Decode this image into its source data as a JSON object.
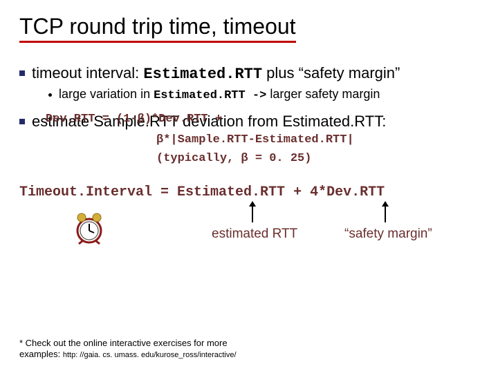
{
  "title": "TCP round trip time, timeout",
  "bullet1": {
    "lead": "timeout interval:",
    "code": "Estimated.RTT",
    "tail": " plus “safety margin”"
  },
  "sub1": {
    "a": "large variation in ",
    "code": "Estimated.RTT ->",
    "b": " larger safety margin"
  },
  "bullet2_overlap": "estimate Sample.RTT deviation from Estimated.RTT:",
  "dev_overlay": "Dev.RTT = (1-β)*Dev.RTT +",
  "formula2": "β*|Sample.RTT-Estimated.RTT|",
  "formula3": "(typically, β = 0. 25)",
  "timeout_formula": "Timeout.Interval = Estimated.RTT + 4*Dev.RTT",
  "label_est": "estimated RTT",
  "label_safety": "“safety margin”",
  "footnote_a": "* Check out the online interactive exercises for more examples: ",
  "footnote_url": "http: //gaia. cs. umass. edu/kurose_ross/interactive/"
}
